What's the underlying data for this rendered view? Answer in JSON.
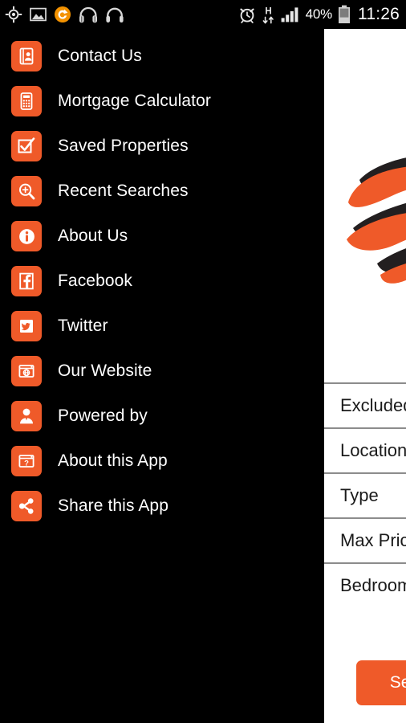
{
  "status_bar": {
    "left_icons": [
      {
        "name": "gps-location-icon"
      },
      {
        "name": "image-photo-icon"
      },
      {
        "name": "sync-circle-icon"
      },
      {
        "name": "headphones-icon"
      },
      {
        "name": "headset-icon"
      }
    ],
    "right_icons": [
      {
        "name": "alarm-clock-icon"
      },
      {
        "name": "hspa-data-icon",
        "label": "H"
      },
      {
        "name": "signal-bars-icon"
      }
    ],
    "battery_percent": "40%",
    "time": "11:26"
  },
  "drawer": {
    "items": [
      {
        "label": "Contact Us",
        "icon": "contact-card-icon"
      },
      {
        "label": "Mortgage Calculator",
        "icon": "calculator-icon"
      },
      {
        "label": "Saved Properties",
        "icon": "checkbox-check-icon"
      },
      {
        "label": "Recent Searches",
        "icon": "search-plus-icon"
      },
      {
        "label": "About Us",
        "icon": "info-circle-icon"
      },
      {
        "label": "Facebook",
        "icon": "facebook-icon"
      },
      {
        "label": "Twitter",
        "icon": "twitter-bird-icon"
      },
      {
        "label": "Our Website",
        "icon": "browser-globe-icon"
      },
      {
        "label": "Powered by",
        "icon": "person-icon"
      },
      {
        "label": "About this App",
        "icon": "browser-question-icon"
      },
      {
        "label": "Share this App",
        "icon": "share-nodes-icon"
      }
    ]
  },
  "content": {
    "logo_name": "globe-sphere-logo",
    "form_fields": [
      {
        "label": "Excluded"
      },
      {
        "label": "Location"
      },
      {
        "label": "Type"
      },
      {
        "label": "Max Price"
      },
      {
        "label": "Bedrooms"
      }
    ],
    "search_button_label": "Search"
  },
  "colors": {
    "accent_orange": "#ef5a29",
    "drawer_background": "#000000",
    "panel_background": "#ffffff",
    "divider": "#8c8c8c"
  }
}
